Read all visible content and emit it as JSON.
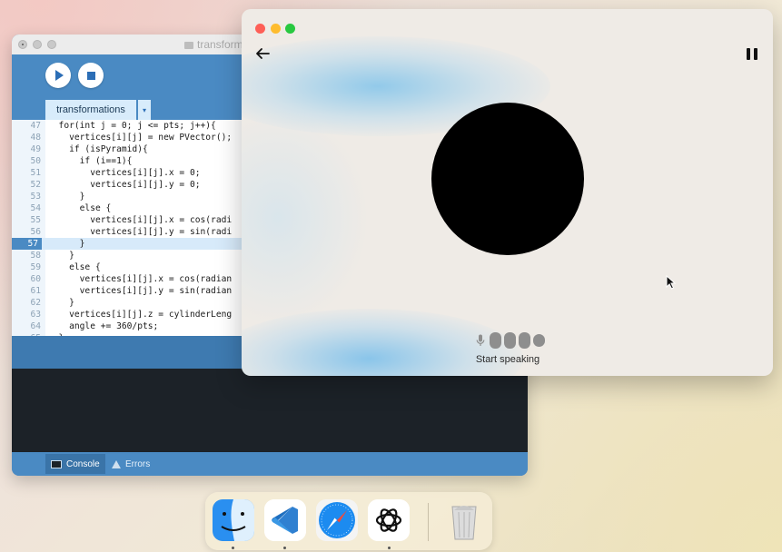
{
  "processing_window": {
    "title": "transform",
    "tab_label": "transformations",
    "tab_dropdown_glyph": "▾",
    "code_lines": [
      {
        "num": "47",
        "text": "  for(int j = 0; j <= pts; j++){"
      },
      {
        "num": "48",
        "text": "    vertices[i][j] = new PVector();"
      },
      {
        "num": "49",
        "text": "    if (isPyramid){"
      },
      {
        "num": "50",
        "text": "      if (i==1){"
      },
      {
        "num": "51",
        "text": "        vertices[i][j].x = 0;"
      },
      {
        "num": "52",
        "text": "        vertices[i][j].y = 0;"
      },
      {
        "num": "53",
        "text": "      }"
      },
      {
        "num": "54",
        "text": "      else {"
      },
      {
        "num": "55",
        "text": "        vertices[i][j].x = cos(radi"
      },
      {
        "num": "56",
        "text": "        vertices[i][j].y = sin(radi"
      },
      {
        "num": "57",
        "text": "      }"
      },
      {
        "num": "58",
        "text": "    }"
      },
      {
        "num": "59",
        "text": "    else {"
      },
      {
        "num": "60",
        "text": "      vertices[i][j].x = cos(radian"
      },
      {
        "num": "61",
        "text": "      vertices[i][j].y = sin(radian"
      },
      {
        "num": "62",
        "text": "    }"
      },
      {
        "num": "63",
        "text": "    vertices[i][j].z = cylinderLeng"
      },
      {
        "num": "64",
        "text": "    angle += 360/pts;"
      },
      {
        "num": "65",
        "text": "  }"
      }
    ],
    "highlighted_line": "57",
    "console_tab": "Console",
    "errors_tab": "Errors"
  },
  "voice_window": {
    "status_label": "Start speaking",
    "orb_color": "#000000",
    "glow_color": "#82c4eb"
  },
  "dock": {
    "apps": [
      "Finder",
      "Visual Studio Code",
      "Safari",
      "ChatGPT",
      "Trash"
    ]
  },
  "colors": {
    "processing_blue": "#4a8ac3",
    "traffic_red": "#fe5f57",
    "traffic_yellow": "#febc2e",
    "traffic_green": "#28c840"
  }
}
